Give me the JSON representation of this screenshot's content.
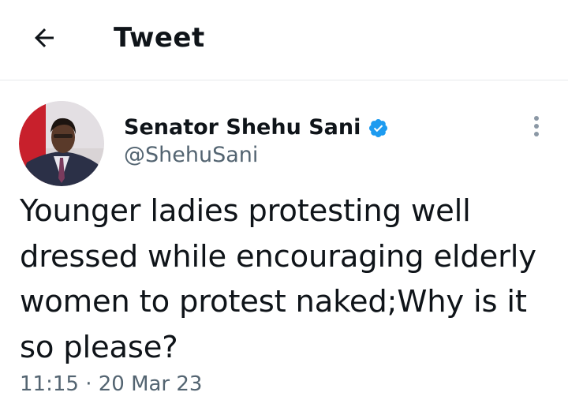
{
  "header": {
    "title": "Tweet",
    "back_icon": "arrow-left-icon"
  },
  "tweet": {
    "author_name": "Senator Shehu Sani",
    "handle": "@ShehuSani",
    "verified_icon": "verified-badge-icon",
    "more_icon": "more-vertical-icon",
    "text": "Younger ladies protesting well dressed while encouraging elderly women to protest naked;Why is it so please?",
    "timestamp": "11:15 · 20 Mar 23"
  },
  "colors": {
    "text": "#0f1419",
    "secondary_text": "#536471",
    "verified_blue": "#1d9bf0",
    "divider": "#e6e9ec"
  }
}
